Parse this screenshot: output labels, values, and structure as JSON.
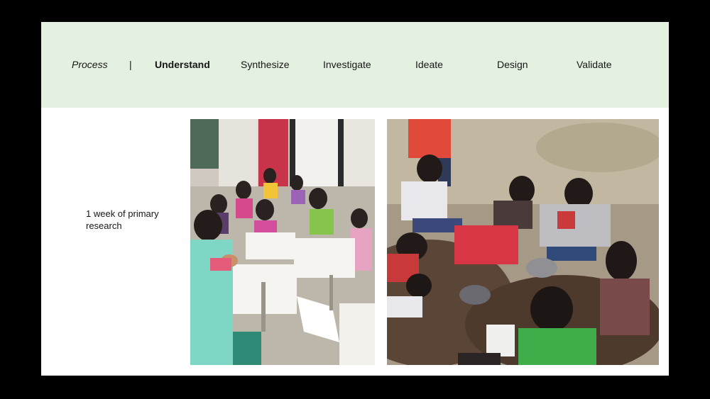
{
  "nav": {
    "process_label": "Process",
    "separator": "|",
    "steps": [
      {
        "label": "Understand",
        "active": true
      },
      {
        "label": "Synthesize",
        "active": false
      },
      {
        "label": "Investigate",
        "active": false
      },
      {
        "label": "Ideate",
        "active": false
      },
      {
        "label": "Design",
        "active": false
      },
      {
        "label": "Validate",
        "active": false
      }
    ]
  },
  "content": {
    "caption": "1 week of primary research"
  },
  "photos": [
    {
      "name": "classroom-activity-photo"
    },
    {
      "name": "outdoor-activity-photo"
    }
  ],
  "colors": {
    "header_band": "#e4f1e1",
    "slide_background": "#ffffff",
    "frame": "#000000",
    "text": "#161616"
  }
}
